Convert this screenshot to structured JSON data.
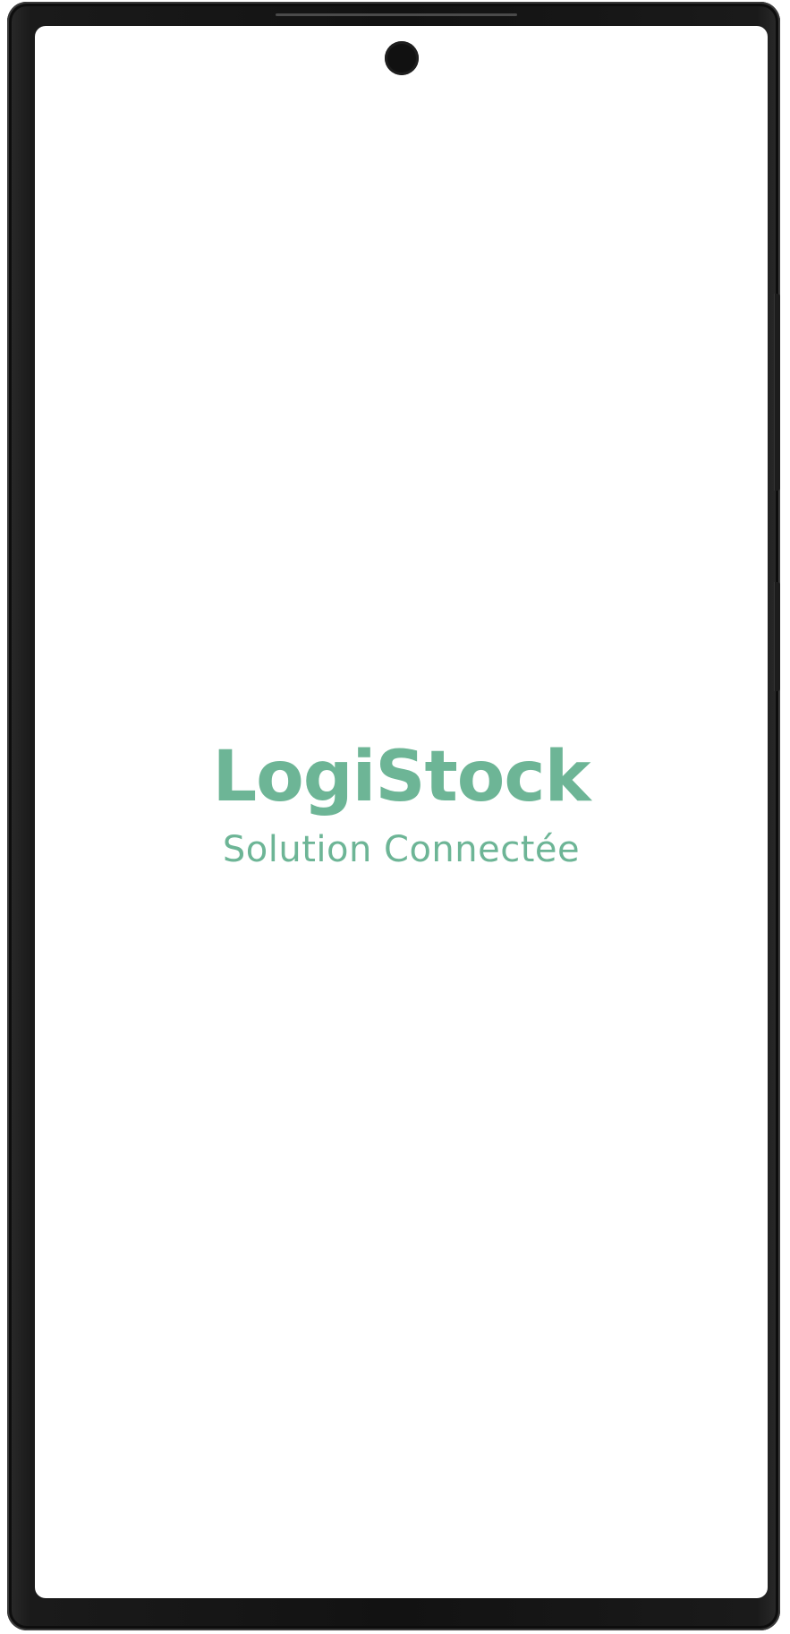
{
  "app": {
    "title": "LogiStock",
    "subtitle": "Solution Connectée"
  },
  "colors": {
    "brand": "#6db596",
    "frame": "#141414",
    "screen_background": "#ffffff",
    "camera": "#111111"
  },
  "icons": {
    "camera": "front-camera-icon"
  }
}
